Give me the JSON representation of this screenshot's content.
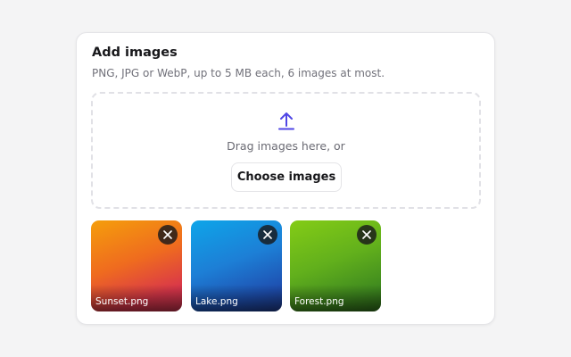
{
  "uploader": {
    "title": "Add images",
    "hint": "PNG, JPG or WebP, up to 5 MB each, 6 images at most.",
    "dropzone": {
      "icon": "upload-icon",
      "text": "Drag images here, or",
      "button_label": "Choose images"
    },
    "images": [
      {
        "name": "Sunset.png",
        "remove_icon": "close-icon"
      },
      {
        "name": "Lake.png",
        "remove_icon": "close-icon"
      },
      {
        "name": "Forest.png",
        "remove_icon": "close-icon"
      }
    ]
  },
  "colors": {
    "accent": "#4f46e5",
    "page_background": "#f4f4f5",
    "card_background": "#ffffff"
  }
}
